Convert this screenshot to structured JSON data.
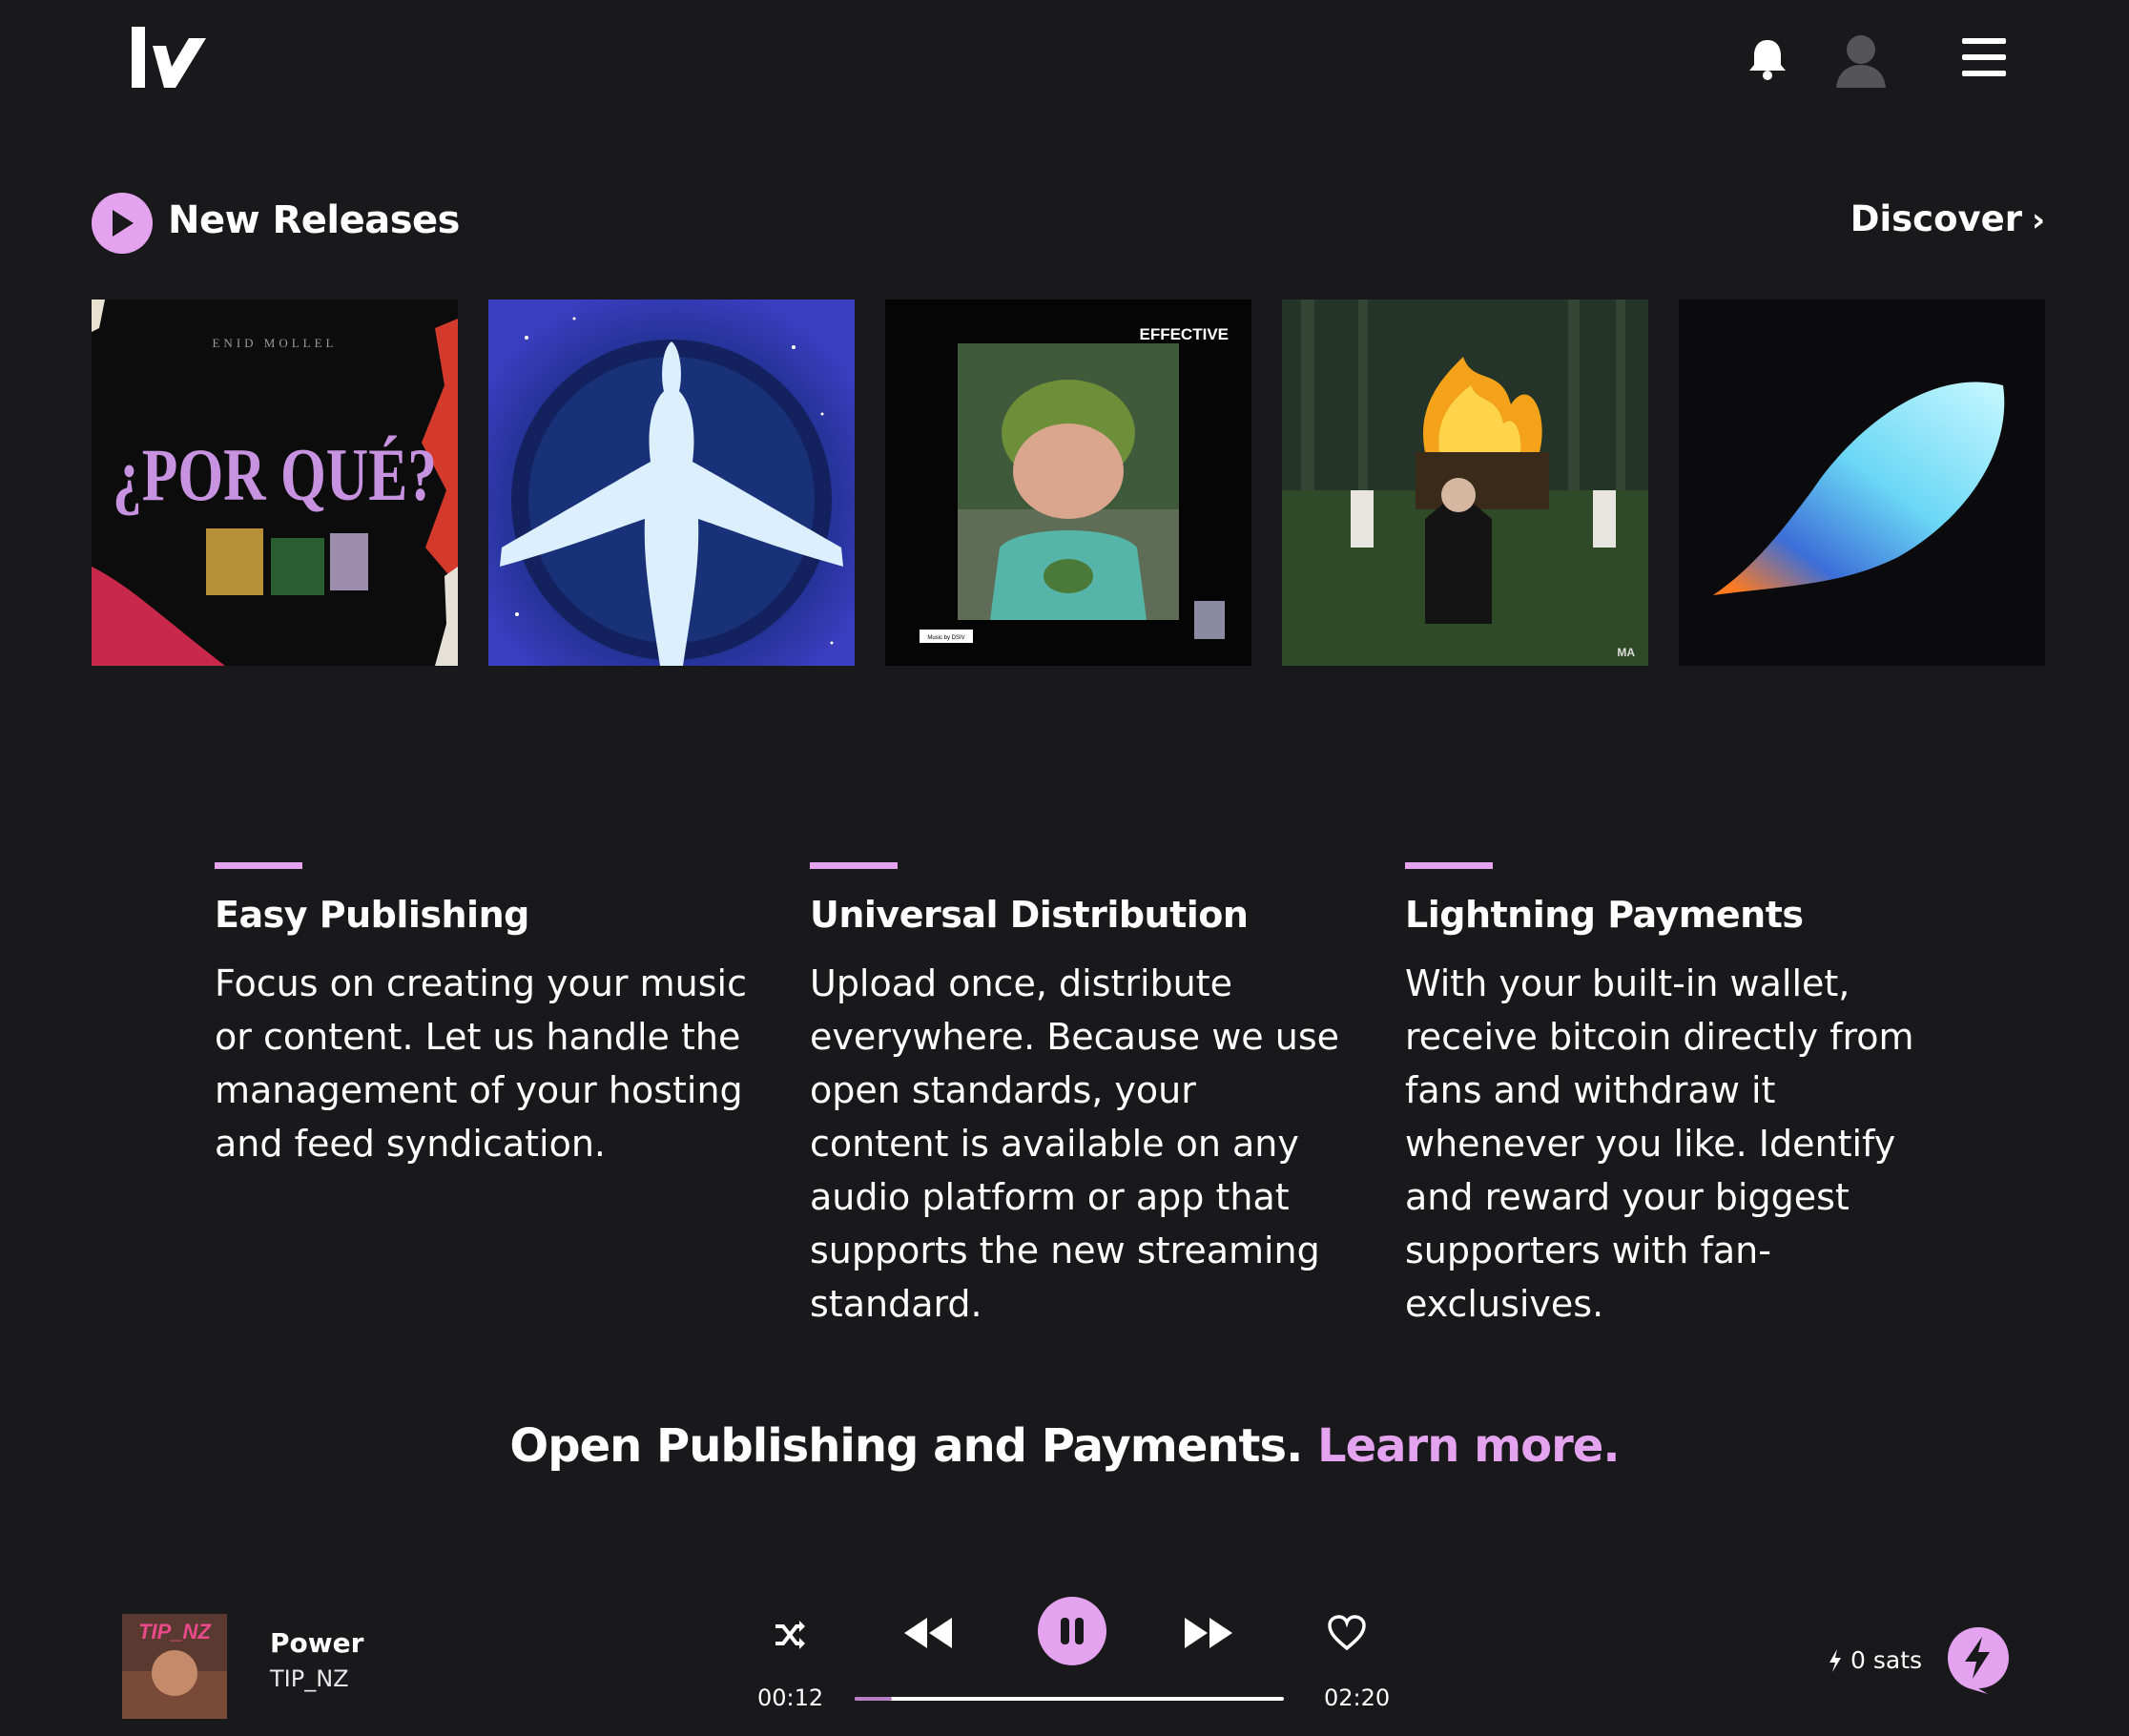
{
  "header": {
    "logo_icon": "wavlake-logo",
    "notification_icon": "bell-icon",
    "account_icon": "user-avatar-icon",
    "menu_icon": "hamburger-menu-icon"
  },
  "new_releases": {
    "title": "New Releases",
    "discover_label": "Discover",
    "covers": [
      {
        "text_top": "ENID MOLLEL",
        "text_main": "¿POR QUÉ?"
      },
      {
        "text_top": "",
        "text_main": ""
      },
      {
        "text_top": "EFFECTIVE",
        "text_main": "Music by DSIV"
      },
      {
        "text_top": "",
        "text_main": "MA"
      },
      {
        "text_top": "",
        "text_main": ""
      }
    ]
  },
  "features": [
    {
      "title": "Easy Publishing",
      "body": "Focus on creating your music or content. Let us handle the management of your hosting and feed syndication."
    },
    {
      "title": "Universal Distribution",
      "body": "Upload once, distribute everywhere. Because we use open standards, your content is available on any audio platform or app that supports the new streaming standard."
    },
    {
      "title": "Lightning Payments",
      "body": "With your built-in wallet, receive bitcoin directly from fans and withdraw it whenever you like. Identify and reward your biggest supporters with fan-exclusives."
    }
  ],
  "tagline": {
    "text": "Open Publishing and Payments.",
    "link": "Learn more."
  },
  "player": {
    "track_title": "Power",
    "artist": "TIP_NZ",
    "thumb_text": "TIP_NZ",
    "elapsed": "00:12",
    "duration": "02:20",
    "progress_fraction": 0.086,
    "sats": "0 sats",
    "accent": "#e4a3ef"
  }
}
